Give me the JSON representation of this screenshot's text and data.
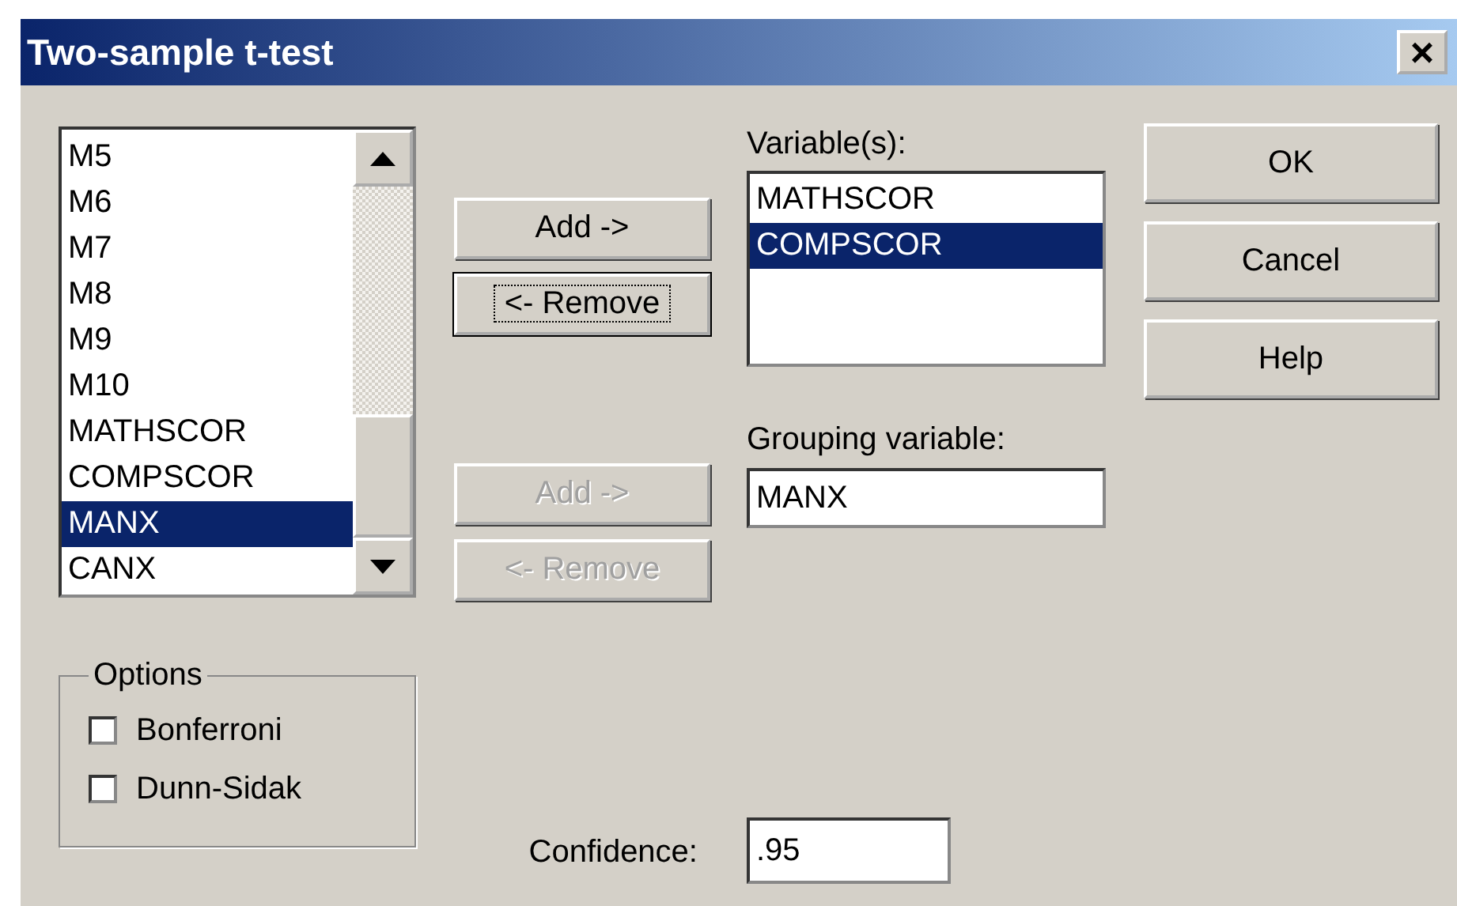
{
  "window": {
    "title": "Two-sample t-test",
    "close": "×"
  },
  "source_list": {
    "items": [
      {
        "label": "M5",
        "selected": false
      },
      {
        "label": "M6",
        "selected": false
      },
      {
        "label": "M7",
        "selected": false
      },
      {
        "label": "M8",
        "selected": false
      },
      {
        "label": "M9",
        "selected": false
      },
      {
        "label": "M10",
        "selected": false
      },
      {
        "label": "MATHSCOR",
        "selected": false
      },
      {
        "label": "COMPSCOR",
        "selected": false
      },
      {
        "label": "MANX",
        "selected": true
      },
      {
        "label": "CANX",
        "selected": false
      }
    ]
  },
  "variable_buttons": [
    {
      "label": "Add ->",
      "disabled": false,
      "focused": false
    },
    {
      "label": "<- Remove",
      "disabled": false,
      "focused": true
    }
  ],
  "grouping_buttons": [
    {
      "label": "Add ->",
      "disabled": true,
      "focused": false
    },
    {
      "label": "<- Remove",
      "disabled": true,
      "focused": false
    }
  ],
  "variables": {
    "label": "Variable(s):",
    "items": [
      {
        "label": "MATHSCOR",
        "selected": false
      },
      {
        "label": "COMPSCOR",
        "selected": true
      }
    ]
  },
  "grouping": {
    "label": "Grouping variable:",
    "value": "MANX"
  },
  "actions": [
    "OK",
    "Cancel",
    "Help"
  ],
  "options": {
    "title": "Options",
    "items": [
      {
        "label": "Bonferroni",
        "checked": false
      },
      {
        "label": "Dunn-Sidak",
        "checked": false
      }
    ]
  },
  "confidence": {
    "label": "Confidence:",
    "value": ".95"
  }
}
